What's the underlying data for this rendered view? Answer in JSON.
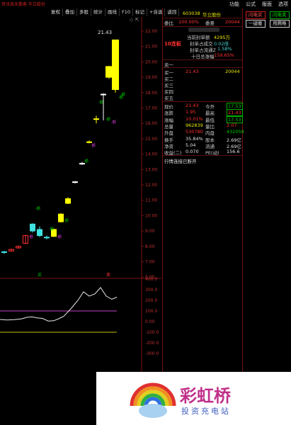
{
  "topbar": {
    "title": "资讯周末散客  华立股份",
    "menu": [
      "功能",
      "公式",
      "版面",
      "选项"
    ]
  },
  "toolbar": [
    "复权",
    "叠加",
    "多股",
    "统计",
    "画线",
    "F10",
    "标记",
    "+自选",
    "返回"
  ],
  "price_axis": [
    "22.00",
    "21.00",
    "20.00",
    "19.00",
    "18.00",
    "17.00",
    "16.00",
    "15.00",
    "14.00",
    "13.00",
    "12.00",
    "11.00",
    "10.00",
    "9.00",
    "8.00",
    "7.00",
    "6.00"
  ],
  "indicator_axis": [
    "400.0",
    "300.0",
    "200.0",
    "100.0",
    "0.00",
    "-100.0",
    "-200.0",
    "-300.0"
  ],
  "chart": {
    "high_label": "21.43",
    "buy_marker": "买",
    "sell_marker": "卖",
    "candles": [
      {
        "o": 7.6,
        "c": 7.65,
        "h": 7.7,
        "l": 7.5,
        "color": "cyan"
      },
      {
        "o": 7.7,
        "c": 7.8,
        "h": 7.85,
        "l": 7.65,
        "color": "red"
      },
      {
        "o": 7.9,
        "c": 8.0,
        "h": 8.05,
        "l": 7.85,
        "color": "red"
      },
      {
        "o": 8.2,
        "c": 8.7,
        "h": 8.75,
        "l": 8.15,
        "color": "red"
      },
      {
        "o": 9.45,
        "c": 9.0,
        "h": 9.5,
        "l": 8.9,
        "color": "cyan_fill"
      },
      {
        "o": 9.1,
        "c": 8.7,
        "h": 9.3,
        "l": 8.6,
        "color": "cyan_fill"
      },
      {
        "o": 8.55,
        "c": 8.6,
        "h": 8.7,
        "l": 8.45,
        "color": "cyan"
      },
      {
        "o": 8.65,
        "c": 9.1,
        "h": 9.15,
        "l": 8.6,
        "color": "yellow"
      },
      {
        "o": 9.6,
        "c": 10.1,
        "h": 10.15,
        "l": 9.55,
        "color": "yellow"
      },
      {
        "o": 10.8,
        "c": 11.1,
        "h": 11.2,
        "l": 10.75,
        "color": "yellow"
      },
      {
        "o": 12.2,
        "c": 12.2,
        "h": 12.25,
        "l": 12.1,
        "color": "white"
      },
      {
        "o": 13.4,
        "c": 13.4,
        "h": 13.5,
        "l": 13.3,
        "color": "white"
      },
      {
        "o": 14.8,
        "c": 14.8,
        "h": 14.9,
        "l": 14.7,
        "color": "yellow"
      },
      {
        "o": 16.3,
        "c": 16.3,
        "h": 16.5,
        "l": 16.0,
        "color": "yellow"
      },
      {
        "o": 17.9,
        "c": 17.9,
        "h": 17.95,
        "l": 16.2,
        "color": "white"
      },
      {
        "o": 19.0,
        "c": 19.7,
        "h": 19.75,
        "l": 18.9,
        "color": "yellow"
      },
      {
        "o": 18.2,
        "c": 21.43,
        "h": 21.43,
        "l": 18.0,
        "color": "yellow"
      }
    ],
    "volume_tags": [
      "-额",
      "-额",
      "-额",
      "-额",
      "-额",
      "-额",
      "-额",
      "-额",
      "-额",
      "-额",
      "-额",
      "-额"
    ]
  },
  "quote": {
    "code": "603038",
    "name": "华立股份",
    "weibi_label": "委比",
    "weibi_value": "100.00%",
    "weicha_label": "委差",
    "weicha_value": "20044",
    "lianban": "10连板",
    "fengdan": [
      {
        "label": "当前封单额",
        "value": "4295万"
      },
      {
        "label": "封单占成交",
        "value": "0.02倍"
      },
      {
        "label": "封单占流通Z",
        "value": "1.58%"
      },
      {
        "label": "十日总涨幅",
        "value": "159.65%"
      }
    ],
    "buy_sell": [
      {
        "label": "卖一",
        "price": "",
        "vol": ""
      },
      {
        "label": "买一",
        "price": "21.43",
        "vol": "20044"
      },
      {
        "label": "买二",
        "price": "",
        "vol": ""
      },
      {
        "label": "买三",
        "price": "",
        "vol": ""
      },
      {
        "label": "买四",
        "price": "",
        "vol": ""
      },
      {
        "label": "买五",
        "price": "",
        "vol": ""
      }
    ],
    "stats_left": [
      {
        "label": "现价",
        "value": "21.43"
      },
      {
        "label": "涨跌",
        "value": "1.95"
      },
      {
        "label": "涨幅",
        "value": "10.01%"
      },
      {
        "label": "总量",
        "value": "962839"
      },
      {
        "label": "外盘",
        "value": "530780"
      },
      {
        "label": "换手",
        "value": "35.84%"
      },
      {
        "label": "净资",
        "value": "5.04"
      },
      {
        "label": "收益(二)",
        "value": "0.070"
      }
    ],
    "stats_right": [
      {
        "label": "今开",
        "value": "17.53"
      },
      {
        "label": "最高",
        "value": "21.43"
      },
      {
        "label": "最低",
        "value": "17.53"
      },
      {
        "label": "量比",
        "value": "2.07"
      },
      {
        "label": "内盘",
        "value": "432059"
      },
      {
        "label": "股本",
        "value": "2.69亿"
      },
      {
        "label": "流通",
        "value": "2.69亿"
      },
      {
        "label": "PE(动)",
        "value": "156.6"
      }
    ],
    "status": "行情连接已断开"
  },
  "right_buttons": [
    {
      "label": "闪电买",
      "style": "red"
    },
    {
      "label": "闪电卖",
      "style": "green"
    },
    {
      "label": "一键撤",
      "style": "white"
    },
    {
      "label": "用腾略",
      "style": "white"
    }
  ],
  "watermark": {
    "title": "彩虹桥",
    "subtitle": "投资充电站"
  }
}
